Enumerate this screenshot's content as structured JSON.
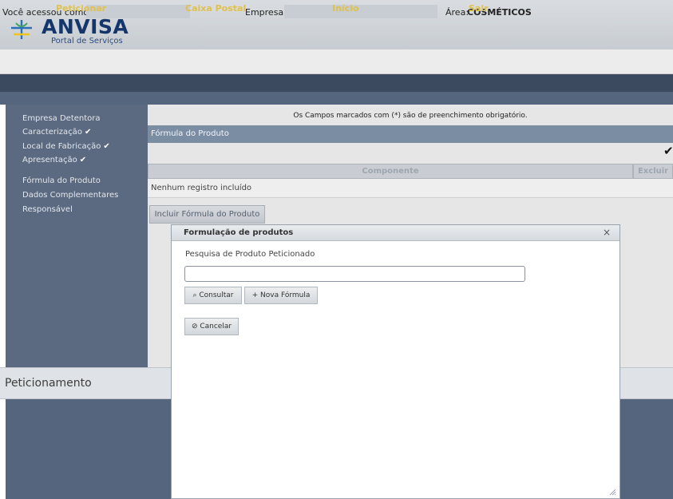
{
  "header": {
    "logo_title": "ANVISA",
    "logo_subtitle": "Portal de Serviços"
  },
  "user_bar": {
    "access_label": "Você acessou como:",
    "company_label": "Empresa:",
    "area_label": "Área:",
    "area_value": "COSMÉTICOS"
  },
  "nav": {
    "items": [
      "Peticionar",
      "Caixa Postal",
      "Início",
      "Sair"
    ]
  },
  "sidebar": {
    "items": [
      {
        "label": "Empresa Detentora",
        "checked": false
      },
      {
        "label": "Caracterização",
        "checked": true
      },
      {
        "label": "Local de Fabricação",
        "checked": true
      },
      {
        "label": "Apresentação",
        "checked": true
      },
      {
        "label": "Fórmula do Produto",
        "checked": false
      },
      {
        "label": "Dados Complementares",
        "checked": false
      },
      {
        "label": "Responsável",
        "checked": false
      }
    ],
    "check_glyph": "✔"
  },
  "main": {
    "notice": "Os Campos marcados com (*) são de preenchimento obrigatório.",
    "section_title": "Fórmula do Produto",
    "check_glyph": "✔",
    "table": {
      "columns": [
        "Componente",
        "Excluir"
      ],
      "empty_message": "Nenhum registro incluído"
    },
    "include_button": "Incluir Fórmula do Produto"
  },
  "bottom": {
    "title": "Peticionamento"
  },
  "dialog": {
    "title": "Formulação de produtos",
    "close_glyph": "×",
    "search_label": "Pesquisa de Produto Peticionado",
    "search_value": "",
    "consultar_button": "⌕ Consultar",
    "nova_formula_button": "+ Nova Fórmula",
    "cancelar_button": "⊘ Cancelar"
  },
  "colors": {
    "nav_bg": "#3b4a5e",
    "nav_text": "#e0c14b",
    "sidebar_bg": "#5b6a80",
    "section_header_bg": "#7b8da3",
    "logo_blue": "#15366b"
  }
}
